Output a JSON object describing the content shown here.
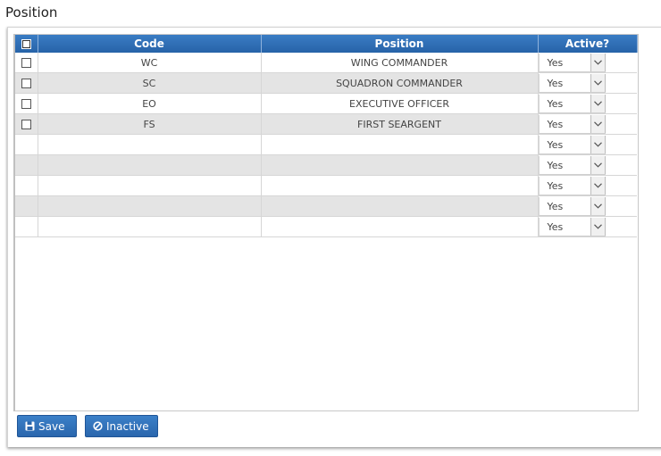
{
  "page": {
    "title": "Position"
  },
  "grid": {
    "headers": {
      "code": "Code",
      "position": "Position",
      "active": "Active?"
    },
    "rows": [
      {
        "code": "WC",
        "position": "WING COMMANDER",
        "active": "Yes"
      },
      {
        "code": "SC",
        "position": "SQUADRON COMMANDER",
        "active": "Yes"
      },
      {
        "code": "EO",
        "position": "EXECUTIVE OFFICER",
        "active": "Yes"
      },
      {
        "code": "FS",
        "position": "FIRST SEARGENT",
        "active": "Yes"
      },
      {
        "code": "",
        "position": "",
        "active": "Yes"
      },
      {
        "code": "",
        "position": "",
        "active": "Yes"
      },
      {
        "code": "",
        "position": "",
        "active": "Yes"
      },
      {
        "code": "",
        "position": "",
        "active": "Yes"
      },
      {
        "code": "",
        "position": "",
        "active": "Yes"
      }
    ]
  },
  "actions": {
    "save_label": "Save",
    "inactive_label": "Inactive"
  },
  "colors": {
    "header": "#2e6fb6",
    "button": "#2a66ad",
    "alt_row": "#e4e4e4"
  },
  "icons": {
    "save": "floppy-disk-icon",
    "inactive": "ban-icon",
    "dropdown": "chevron-down-icon"
  }
}
